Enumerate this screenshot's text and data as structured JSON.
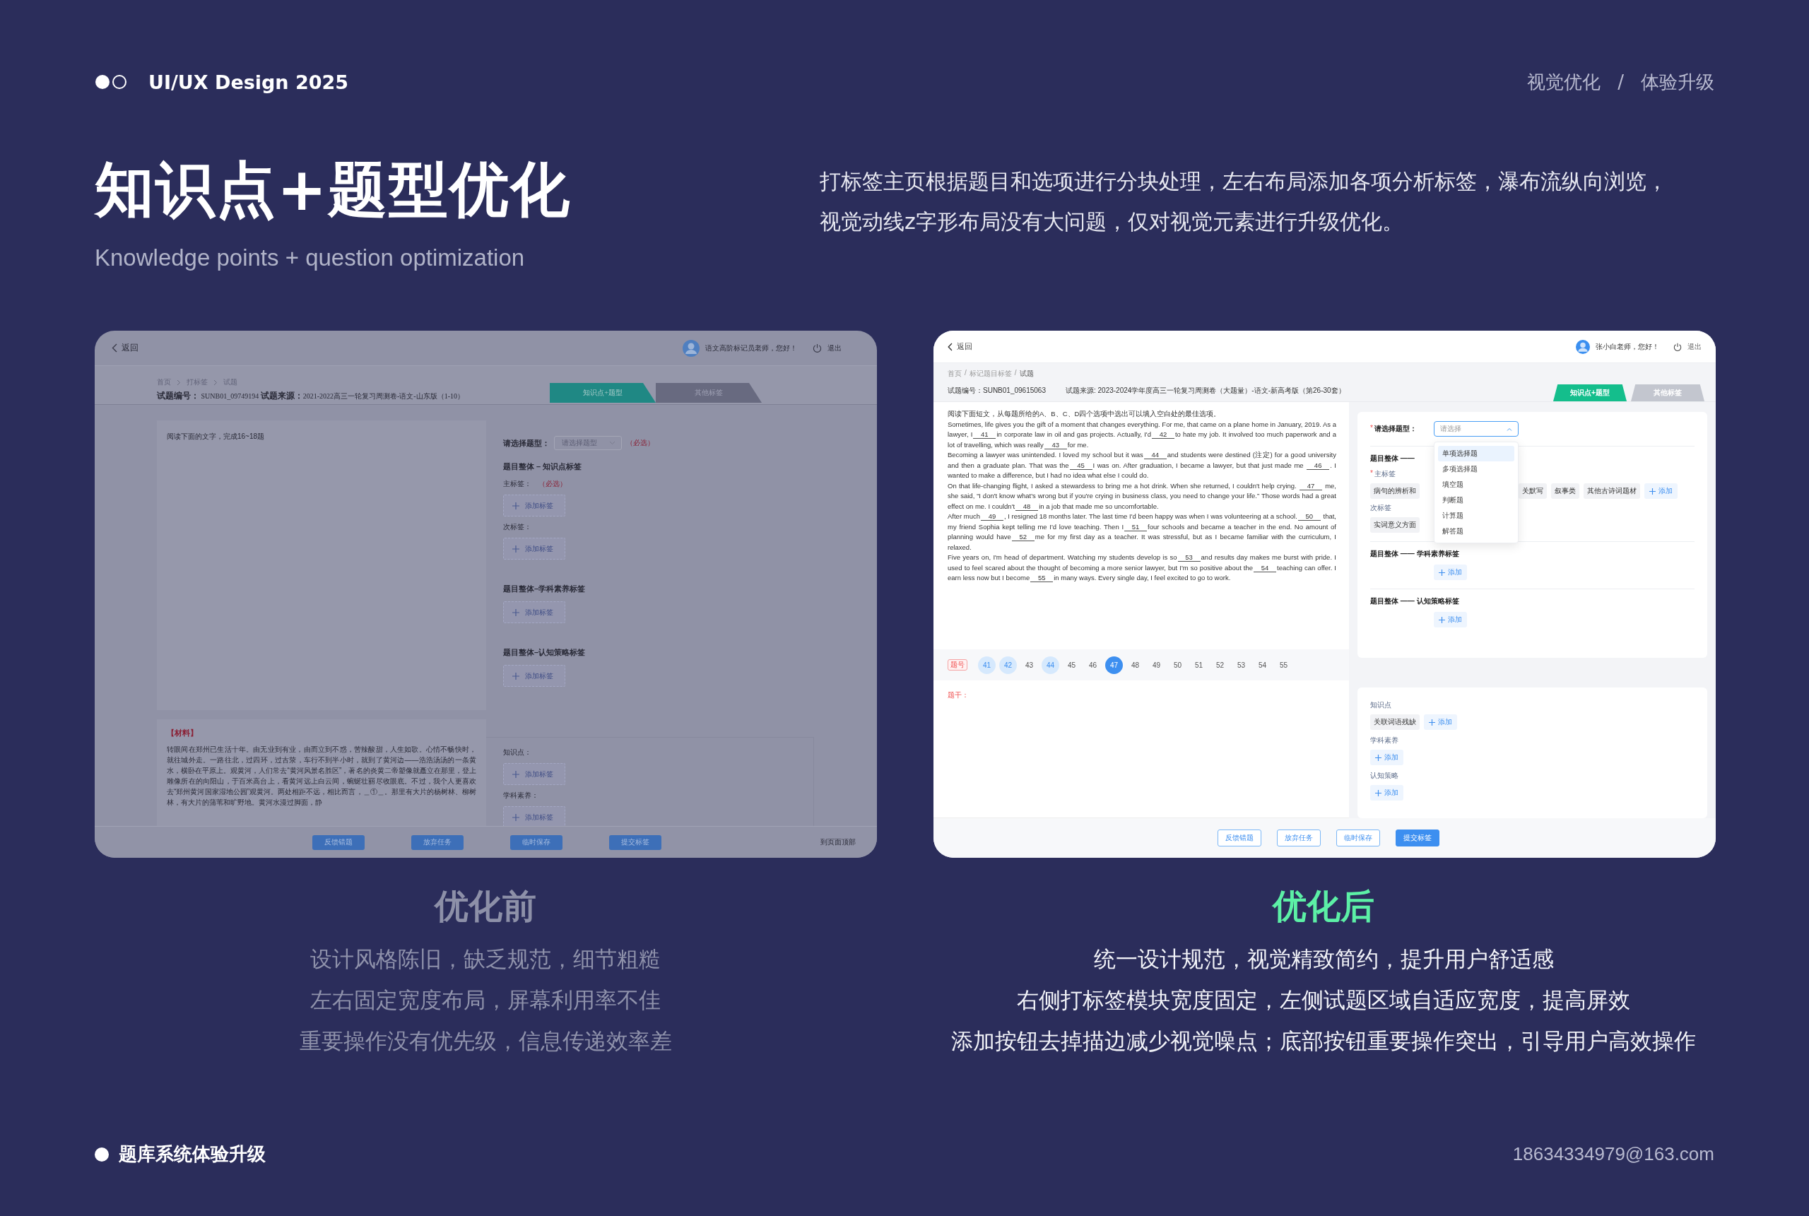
{
  "header": {
    "brand": "UI/UX Design 2025",
    "nav": [
      "视觉优化",
      "体验升级"
    ],
    "nav_separator": "/"
  },
  "title": "知识点+题型优化",
  "subtitle": "Knowledge points + question optimization",
  "description": [
    "打标签主页根据题目和选项进行分块处理，左右布局添加各项分析标签，瀑布流纵向浏览，",
    "视觉动线z字形布局没有大问题，仅对视觉元素进行升级优化。"
  ],
  "before": {
    "back": "返回",
    "greeting": "语文高阶标记员老师，您好！",
    "logout": "退出",
    "breadcrumb": [
      "首页",
      "打标签",
      "试题"
    ],
    "info": "**试题编号：** SUNB01_09749194 **试题来源：**2021-2022高三一轮复习周测卷-语文-山东版（1-10）",
    "tabs": [
      {
        "label": "知识点+题型",
        "selected": true
      },
      {
        "label": "其他标签",
        "selected": false
      }
    ],
    "instruction": "阅读下面的文字，完成16~18题",
    "material_label": "【材料】",
    "material": "转眼间在郑州已生活十年。由无业到有业，由而立到不惑，苦辣酸甜，人生如歌。心情不畅快时，就往城外走。一路往北，过四环，过古荥，车行不到半小时，就到了黄河边——浩浩汤汤的一条黄水，横卧在平原上。观黄河，人们常去“黄河风景名胜区”，著名的炎黄二帝塑像就矗立在那里，登上雕像所在的向阳山，于百米高台上，看黄河远上白云间，蜿蜒壮丽尽收眼底。不过，我个人更喜欢去“郑州黄河国家湿地公园”观黄河。两处相距不远，相比而言，＿①＿。那里有大片的杨树林、柳树林，有大片的蒲苇和旷野地。黄河水漫过脚面，静",
    "type_label": "请选择题型：",
    "type_placeholder": "请选择题型",
    "type_required": "（必选）",
    "sections": [
      {
        "title": "题目整体 – 知识点标签",
        "fields": [
          {
            "label": "主标签：",
            "required": "（必选）",
            "add": "添加标签"
          },
          {
            "label": "次标签：",
            "add": "添加标签"
          }
        ]
      },
      {
        "title": "题目整体–学科素养标签",
        "fields": [
          {
            "add": "添加标签"
          }
        ]
      },
      {
        "title": "题目整体–认知策略标签",
        "fields": [
          {
            "add": "添加标签"
          }
        ]
      }
    ],
    "extra": [
      {
        "label": "知识点：",
        "add": "添加标签"
      },
      {
        "label": "学科素养：",
        "add": "添加标签"
      }
    ],
    "buttons": [
      "反馈错题",
      "放弃任务",
      "临时保存",
      "提交标签"
    ],
    "top_link": "到页面顶部"
  },
  "after": {
    "back": "返回",
    "greeting": "张小白老师，您好！",
    "logout": "退出",
    "breadcrumb": [
      "首页",
      "标记题目标签",
      "试题"
    ],
    "breadcrumb_separator": "/",
    "id": "试题编号：SUNB01_09615063",
    "source": "试题来源: 2023-2024学年度高三一轮复习周测卷（大题量）-语文-新高考版（第26-30套）",
    "tabs": [
      {
        "label": "知识点+题型",
        "selected": true
      },
      {
        "label": "其他标签",
        "selected": false
      }
    ],
    "passage": [
      [
        {
          "kind": "text",
          "text": "阅读下面短文，从每题所给的A、B、C、D四个选项中选出可以填入空白处的最佳选项。"
        }
      ],
      [
        {
          "kind": "text",
          "text": "Sometimes, life gives you the gift of a moment that changes everything. For me, that came on a plane home in January, 2019. As a lawyer, I"
        },
        {
          "kind": "blank",
          "text": "41"
        },
        {
          "kind": "text",
          "text": "in corporate law in oil and gas projects. Actually, I'd"
        },
        {
          "kind": "blank",
          "text": "42"
        },
        {
          "kind": "text",
          "text": "to hate my job. It involved too much paperwork and a lot of travelling, which was really"
        },
        {
          "kind": "blank",
          "text": "43"
        },
        {
          "kind": "text",
          "text": "for me."
        }
      ],
      [
        {
          "kind": "text",
          "text": "Becoming a lawyer was unintended. I loved my school but it was"
        },
        {
          "kind": "blank",
          "text": "44"
        },
        {
          "kind": "text",
          "text": "and students were destined (注定) for a good university and then a graduate plan. That was the"
        },
        {
          "kind": "blank",
          "text": "45"
        },
        {
          "kind": "text",
          "text": "I was on. After graduation, I became a lawyer, but that just made me "
        },
        {
          "kind": "blank",
          "text": "46"
        },
        {
          "kind": "text",
          "text": ". I wanted to make a difference, but I had no idea what else I could do."
        }
      ],
      [
        {
          "kind": "text",
          "text": "On that life-changing flight, I asked a stewardess to bring me a hot drink. When she returned, I couldn't help crying. "
        },
        {
          "kind": "blank",
          "text": "47"
        },
        {
          "kind": "text",
          "text": " me, she said, “I don't know what's wrong but if you're crying in business class, you need to change your life.” Those words had a great effect on me. I couldn't"
        },
        {
          "kind": "blank",
          "text": "48"
        },
        {
          "kind": "text",
          "text": "in a job that made me so uncomfortable."
        }
      ],
      [
        {
          "kind": "text",
          "text": "After much"
        },
        {
          "kind": "blank",
          "text": "49"
        },
        {
          "kind": "text",
          "text": ", I resigned 18 months later. The last time I'd been happy was when I was volunteering at a school."
        },
        {
          "kind": "blank",
          "text": "50"
        },
        {
          "kind": "text",
          "text": " that, my friend Sophia kept telling me I'd love teaching. Then I"
        },
        {
          "kind": "blank",
          "text": "51"
        },
        {
          "kind": "text",
          "text": "four schools and became a teacher in the end. No amount of planning would have"
        },
        {
          "kind": "blank",
          "text": "52"
        },
        {
          "kind": "text",
          "text": "me for my first day as a teacher. It was stressful, but as I became familiar with the curriculum, I relaxed."
        }
      ],
      [
        {
          "kind": "text",
          "text": "Five years on, I'm head of department. Watching my students develop is so"
        },
        {
          "kind": "blank",
          "text": "53"
        },
        {
          "kind": "text",
          "text": "and results day makes me burst with pride. I used to feel scared about the thought of becoming a more senior lawyer, but I'm so positive about the"
        },
        {
          "kind": "blank",
          "text": "54"
        },
        {
          "kind": "text",
          "text": "teaching can offer. I earn less now but I become"
        },
        {
          "kind": "blank",
          "text": "55"
        },
        {
          "kind": "text",
          "text": "in many ways. Every single day, I feel excited to go to work."
        }
      ]
    ],
    "pages_label": "题号",
    "pages": [
      {
        "label": "41",
        "selected": false,
        "answered": true
      },
      {
        "label": "42",
        "selected": false,
        "answered": true
      },
      {
        "label": "43",
        "selected": false,
        "answered": false
      },
      {
        "label": "44",
        "selected": false,
        "answered": true
      },
      {
        "label": "45",
        "selected": false,
        "answered": false
      },
      {
        "label": "46",
        "selected": false,
        "answered": false
      },
      {
        "label": "47",
        "selected": true,
        "answered": false
      },
      {
        "label": "48",
        "selected": false,
        "answered": false
      },
      {
        "label": "49",
        "selected": false,
        "answered": false
      },
      {
        "label": "50",
        "selected": false,
        "answered": false
      },
      {
        "label": "51",
        "selected": false,
        "answered": false
      },
      {
        "label": "52",
        "selected": false,
        "answered": false
      },
      {
        "label": "53",
        "selected": false,
        "answered": false
      },
      {
        "label": "54",
        "selected": false,
        "answered": false
      },
      {
        "label": "55",
        "selected": false,
        "answered": false
      }
    ],
    "stem_label": "题干：",
    "type_label": "请选择题型：",
    "type_required": "*",
    "type_select": {
      "placeholder": "请选择",
      "expanded": true,
      "options": [
        {
          "label": "单项选择题",
          "selected": true
        },
        {
          "label": "多项选择题",
          "selected": false
        },
        {
          "label": "填空题",
          "selected": false
        },
        {
          "label": "判断题",
          "selected": false
        },
        {
          "label": "计算题",
          "selected": false
        },
        {
          "label": "解答题",
          "selected": false
        }
      ]
    },
    "sections": [
      {
        "title": "题目整体 ——",
        "fields": [
          {
            "label": "主标签",
            "required": "*",
            "tags": [
              "病句的辨析和",
              "关默写",
              "叙事类",
              "其他古诗词题材"
            ],
            "add": "添加"
          },
          {
            "label": "次标签",
            "tags": [
              "实词意义方面"
            ]
          }
        ]
      },
      {
        "title": "题目整体 —— 学科素养标签",
        "fields": [
          {
            "add": "添加"
          }
        ]
      },
      {
        "title": "题目整体 —— 认知策略标签",
        "fields": [
          {
            "add": "添加"
          }
        ]
      }
    ],
    "summary": [
      {
        "label": "知识点",
        "tags": [
          "关联词语残缺"
        ],
        "add": "添加"
      },
      {
        "label": "学科素养",
        "add": "添加"
      },
      {
        "label": "认知策略",
        "add": "添加"
      }
    ],
    "buttons": [
      {
        "label": "反馈错题",
        "primary": false
      },
      {
        "label": "放弃任务",
        "primary": false
      },
      {
        "label": "临时保存",
        "primary": false
      },
      {
        "label": "提交标签",
        "primary": true
      }
    ]
  },
  "comparisons": [
    {
      "kind": "before",
      "heading": "优化前",
      "lines": [
        "设计风格陈旧，缺乏规范，细节粗糙",
        "左右固定宽度布局，屏幕利用率不佳",
        "重要操作没有优先级，信息传递效率差"
      ]
    },
    {
      "kind": "after",
      "heading": "优化后",
      "lines": [
        "统一设计规范，视觉精致简约，提升用户舒适感",
        "右侧打标签模块宽度固定，左侧试题区域自适应宽度，提高屏效",
        "添加按钮去掉描边减少视觉噪点；底部按钮重要操作突出，引导用户高效操作"
      ]
    }
  ],
  "footer": {
    "title": "题库系统体验升级",
    "email": "18634334979@163.com"
  }
}
